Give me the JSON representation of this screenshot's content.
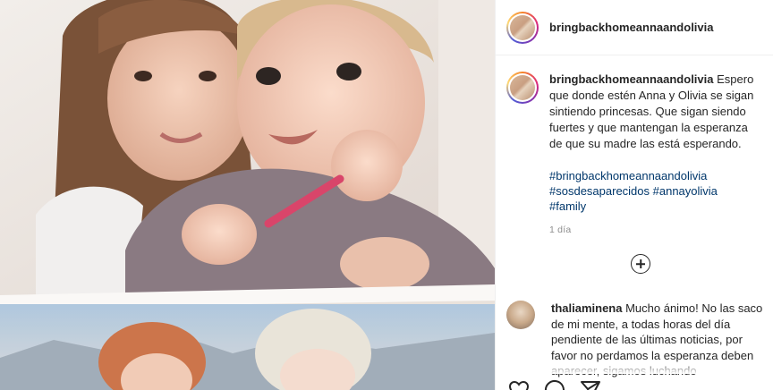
{
  "post": {
    "username": "bringbackhomeannaandolivia",
    "caption_text": "Espero que donde estén Anna y Olivia se sigan sintiendo princesas. Que sigan siendo fuertes y que mantengan la esperanza de que su madre las está esperando.",
    "hashtags": [
      "#bringbackhomeannaandolivia",
      "#sosdesaparecidos #annayolivia",
      "#family"
    ],
    "time_ago": "1 día"
  },
  "comment": {
    "username": "thaliaminena",
    "text": "Mucho ánimo! No las saco de mi mente, a todas horas del día pendiente de las últimas noticias, por favor no perdamos la esperanza deben aparecer, sigamos luchando"
  },
  "icons": {
    "load_more": "plus-circle-icon",
    "like": "heart-icon",
    "comment": "comment-icon",
    "share": "paper-plane-icon",
    "save": "bookmark-icon"
  },
  "colors": {
    "text": "#262626",
    "hashtag": "#00376b",
    "muted": "#8e8e8e",
    "border": "#efefef"
  }
}
